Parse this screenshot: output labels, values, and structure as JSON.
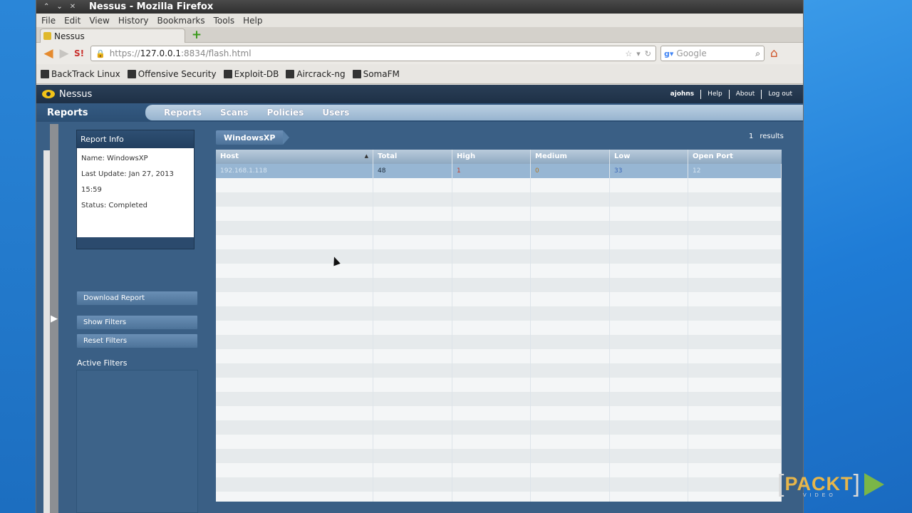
{
  "browser": {
    "window_title": "Nessus - Mozilla Firefox",
    "window_controls": [
      "⌃",
      "⌄",
      "✕"
    ],
    "menu": [
      "File",
      "Edit",
      "View",
      "History",
      "Bookmarks",
      "Tools",
      "Help"
    ],
    "tab_label": "Nessus",
    "url_prefix": "https://",
    "url_host": "127.0.0.1",
    "url_rest": ":8834/flash.html",
    "search_placeholder": "Google",
    "bookmarks": [
      "BackTrack Linux",
      "Offensive Security",
      "Exploit-DB",
      "Aircrack-ng",
      "SomaFM"
    ]
  },
  "nessus": {
    "logo_text": "Nessus",
    "header_links": [
      "ajohns",
      "Help",
      "About",
      "Log out"
    ],
    "section_title": "Reports",
    "nav_tabs": [
      "Reports",
      "Scans",
      "Policies",
      "Users"
    ],
    "report_info": {
      "title": "Report Info",
      "name": "Name: WindowsXP",
      "last_update": "Last Update: Jan 27, 2013 15:59",
      "status": "Status: Completed"
    },
    "buttons": {
      "download": "Download Report",
      "show_filters": "Show Filters",
      "reset_filters": "Reset Filters"
    },
    "active_filters_label": "Active Filters",
    "breadcrumb": "WindowsXP",
    "results_count": "1",
    "results_label": "results",
    "table": {
      "columns": [
        "Host",
        "Total",
        "High",
        "Medium",
        "Low",
        "Open Port"
      ],
      "rows": [
        {
          "host": "192.168.1.118",
          "total": "48",
          "high": "1",
          "medium": "0",
          "low": "33",
          "open_port": "12"
        }
      ]
    }
  },
  "watermark": {
    "brand": "PACKT",
    "sub": "VIDEO"
  },
  "colors": {
    "nessus_blue": "#3a5f85",
    "nav_tabs_bg": "#bcd0e2",
    "selected_row": "#97b6d3"
  }
}
